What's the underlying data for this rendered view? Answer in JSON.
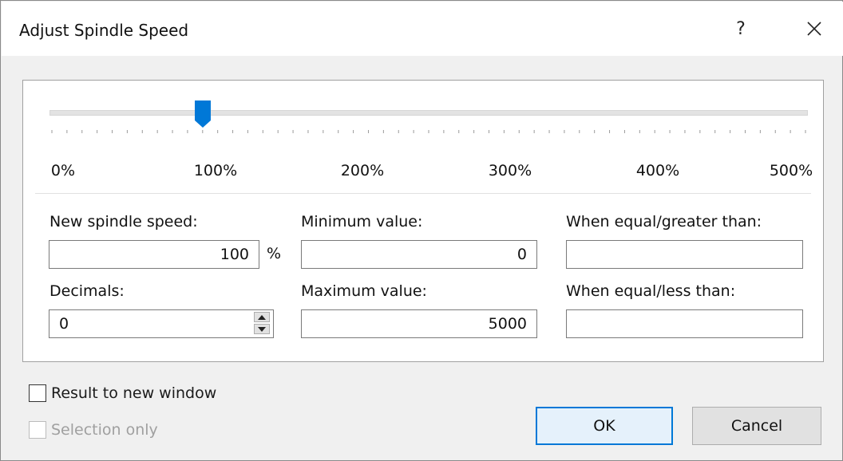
{
  "window": {
    "title": "Adjust Spindle Speed",
    "help_label": "?",
    "close_icon": "close-icon"
  },
  "slider": {
    "value_percent": 100,
    "min_percent": 0,
    "max_percent": 500,
    "tick_labels": [
      "0%",
      "100%",
      "200%",
      "300%",
      "400%",
      "500%"
    ],
    "thumb_color": "#0078d7"
  },
  "fields": {
    "new_speed": {
      "label": "New spindle speed:",
      "value": "100",
      "unit": "%"
    },
    "decimals": {
      "label": "Decimals:",
      "value": "0"
    },
    "minimum": {
      "label": "Minimum value:",
      "value": "0"
    },
    "maximum": {
      "label": "Maximum value:",
      "value": "5000"
    },
    "when_ge": {
      "label": "When equal/greater than:",
      "value": ""
    },
    "when_le": {
      "label": "When equal/less than:",
      "value": ""
    }
  },
  "options": {
    "result_new_window": {
      "label": "Result to new window",
      "checked": false
    },
    "selection_only": {
      "label": "Selection only",
      "checked": false,
      "enabled": false
    }
  },
  "buttons": {
    "ok": "OK",
    "cancel": "Cancel"
  }
}
